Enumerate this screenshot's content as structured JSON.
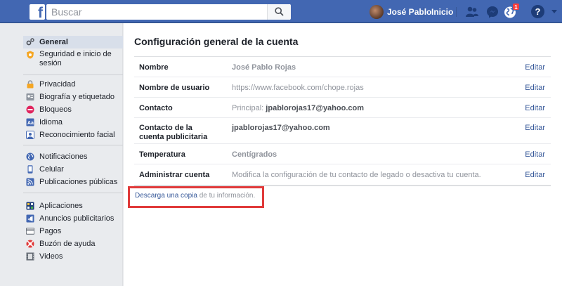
{
  "topbar": {
    "search_placeholder": "Buscar",
    "user_name": "José Pablo",
    "home_label": "Inicio",
    "notification_count": "1",
    "help_label": "?"
  },
  "sidebar": {
    "groups": [
      [
        {
          "label": "General",
          "icon": "gear-icon",
          "color": "#4b4f56"
        },
        {
          "label": "Seguridad e inicio de sesión",
          "icon": "shield-icon",
          "color": "#f5c33b"
        }
      ],
      [
        {
          "label": "Privacidad",
          "icon": "lock-icon",
          "color": "#f5c33b"
        },
        {
          "label": "Biografía y etiquetado",
          "icon": "profile-tag-icon",
          "color": "#8d949e"
        },
        {
          "label": "Bloqueos",
          "icon": "block-icon",
          "color": "#e0245e"
        },
        {
          "label": "Idioma",
          "icon": "language-icon",
          "color": "#4267b2"
        },
        {
          "label": "Reconocimiento facial",
          "icon": "face-recognition-icon",
          "color": "#8d949e"
        }
      ],
      [
        {
          "label": "Notificaciones",
          "icon": "globe-icon",
          "color": "#4267b2"
        },
        {
          "label": "Celular",
          "icon": "phone-icon",
          "color": "#4267b2"
        },
        {
          "label": "Publicaciones públicas",
          "icon": "rss-icon",
          "color": "#4267b2"
        }
      ],
      [
        {
          "label": "Aplicaciones",
          "icon": "apps-icon",
          "color": "#1d3c78"
        },
        {
          "label": "Anuncios publicitarios",
          "icon": "ads-icon",
          "color": "#4267b2"
        },
        {
          "label": "Pagos",
          "icon": "card-icon",
          "color": "#606770"
        },
        {
          "label": "Buzón de ayuda",
          "icon": "lifebuoy-icon",
          "color": "#e03a3a"
        },
        {
          "label": "Videos",
          "icon": "film-icon",
          "color": "#606770"
        }
      ]
    ]
  },
  "main": {
    "title": "Configuración general de la cuenta",
    "rows": [
      {
        "key": "Nombre",
        "value": "José Pablo Rojas",
        "edit": "Editar"
      },
      {
        "key": "Nombre de usuario",
        "value": "https://www.facebook.com/chope.rojas",
        "edit": "Editar"
      },
      {
        "key": "Contacto",
        "value_prefix": "Principal: ",
        "value": "jpablorojas17@yahoo.com",
        "edit": "Editar"
      },
      {
        "key": "Contacto de la cuenta publicitaria",
        "value": "jpablorojas17@yahoo.com",
        "edit": "Editar"
      },
      {
        "key": "Temperatura",
        "value": "Centígrados",
        "edit": "Editar"
      },
      {
        "key": "Administrar cuenta",
        "value": "Modifica la configuración de tu contacto de legado o desactiva tu cuenta.",
        "edit": "Editar"
      }
    ],
    "download": {
      "link": "Descarga una copia",
      "suffix": " de tu información."
    }
  },
  "colors": {
    "brand": "#4267b2",
    "link": "#365899",
    "highlight_box": "#e03a3a"
  }
}
